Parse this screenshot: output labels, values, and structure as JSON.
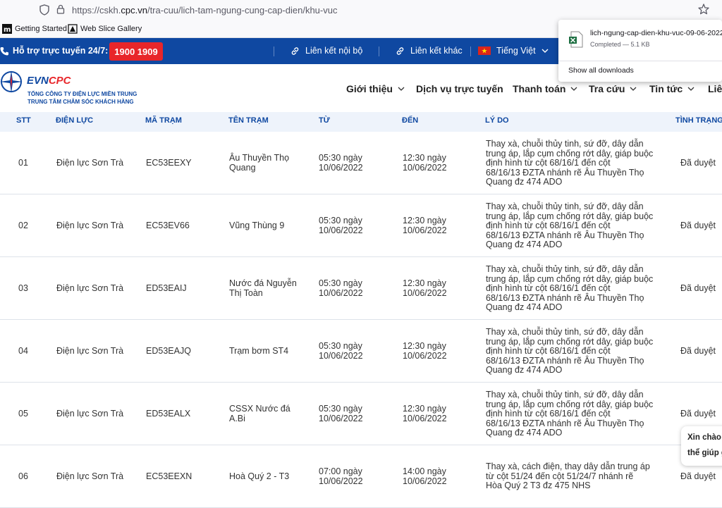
{
  "browser": {
    "url_prefix": "https://cskh.",
    "url_domain": "cpc.vn",
    "url_path": "/tra-cuu/lich-tam-ngung-cung-cap-dien/khu-vuc",
    "bookmarks": [
      "Getting Started",
      "Web Slice Gallery"
    ]
  },
  "downloads": {
    "file_name": "lich-ngung-cap-dien-khu-vuc-09-06-2022",
    "status": "Completed — 5.1 KB",
    "show_all": "Show all downloads"
  },
  "topbar": {
    "support_label": "Hỗ trợ trực tuyến 24/7:",
    "hotline": "1900 1909",
    "link_internal": "Liên kết nội bộ",
    "link_other": "Liên kết khác",
    "language": "Tiếng Việt",
    "colors": {
      "bar": "#0f48a1",
      "hotline": "#e8262a"
    }
  },
  "header": {
    "logo_evn": "EVN",
    "logo_cpc": "CPC",
    "logo_line1": "TỔNG CÔNG TY ĐIỆN LỰC MIỀN TRUNG",
    "logo_line2": "TRUNG TÂM CHĂM SÓC KHÁCH HÀNG",
    "nav": [
      "Giới thiệu",
      "Dịch vụ trực tuyến",
      "Thanh toán",
      "Tra cứu",
      "Tin tức",
      "Liê"
    ]
  },
  "table": {
    "headers": [
      "STT",
      "ĐIỆN LỰC",
      "MÃ TRẠM",
      "TÊN TRẠM",
      "TỪ",
      "ĐẾN",
      "LÝ DO",
      "TÌNH TRẠNG"
    ],
    "rows": [
      {
        "stt": "01",
        "dien_luc": "Điện lực Sơn Trà",
        "ma_tram": "EC53EEXY",
        "ten_tram": [
          "Âu Thuyền Thọ",
          "Quang"
        ],
        "tu": [
          "05:30 ngày",
          "10/06/2022"
        ],
        "den": [
          "12:30 ngày",
          "10/06/2022"
        ],
        "ly_do": [
          "Thay xà, chuỗi thủy tinh, sứ đỡ, dây dẫn",
          "trung áp, lắp cụm chống rớt dây, giáp buộc",
          "định hình từ cột 68/16/1 đến cột",
          "68/16/13 ĐZTA nhánh rẽ Âu Thuyền Thọ",
          "Quang đz 474 ADO"
        ],
        "tinh_trang": "Đã duyệt"
      },
      {
        "stt": "02",
        "dien_luc": "Điện lực Sơn Trà",
        "ma_tram": "EC53EV66",
        "ten_tram": [
          "Vũng Thùng 9"
        ],
        "tu": [
          "05:30 ngày",
          "10/06/2022"
        ],
        "den": [
          "12:30 ngày",
          "10/06/2022"
        ],
        "ly_do": [
          "Thay xà, chuỗi thủy tinh, sứ đỡ, dây dẫn",
          "trung áp, lắp cụm chống rớt dây, giáp buộc",
          "định hình từ cột 68/16/1 đến cột",
          "68/16/13 ĐZTA nhánh rẽ Âu Thuyền Thọ",
          "Quang đz 474 ADO"
        ],
        "tinh_trang": "Đã duyệt"
      },
      {
        "stt": "03",
        "dien_luc": "Điện lực Sơn Trà",
        "ma_tram": "ED53EAIJ",
        "ten_tram": [
          "Nước đá Nguyễn",
          "Thị Toàn"
        ],
        "tu": [
          "05:30 ngày",
          "10/06/2022"
        ],
        "den": [
          "12:30 ngày",
          "10/06/2022"
        ],
        "ly_do": [
          "Thay xà, chuỗi thủy tinh, sứ đỡ, dây dẫn",
          "trung áp, lắp cụm chống rớt dây, giáp buộc",
          "định hình từ cột 68/16/1 đến cột",
          "68/16/13 ĐZTA nhánh rẽ Âu Thuyền Thọ",
          "Quang đz 474 ADO"
        ],
        "tinh_trang": "Đã duyệt"
      },
      {
        "stt": "04",
        "dien_luc": "Điện lực Sơn Trà",
        "ma_tram": "ED53EAJQ",
        "ten_tram": [
          "Trạm bơm ST4"
        ],
        "tu": [
          "05:30 ngày",
          "10/06/2022"
        ],
        "den": [
          "12:30 ngày",
          "10/06/2022"
        ],
        "ly_do": [
          "Thay xà, chuỗi thủy tinh, sứ đỡ, dây dẫn",
          "trung áp, lắp cụm chống rớt dây, giáp buộc",
          "định hình từ cột 68/16/1 đến cột",
          "68/16/13 ĐZTA nhánh rẽ Âu Thuyền Thọ",
          "Quang đz 474 ADO"
        ],
        "tinh_trang": "Đã duyệt"
      },
      {
        "stt": "05",
        "dien_luc": "Điện lực Sơn Trà",
        "ma_tram": "ED53EALX",
        "ten_tram": [
          "CSSX Nước đá",
          "A.Bi"
        ],
        "tu": [
          "05:30 ngày",
          "10/06/2022"
        ],
        "den": [
          "12:30 ngày",
          "10/06/2022"
        ],
        "ly_do": [
          "Thay xà, chuỗi thủy tinh, sứ đỡ, dây dẫn",
          "trung áp, lắp cụm chống rớt dây, giáp buộc",
          "định hình từ cột 68/16/1 đến cột",
          "68/16/13 ĐZTA nhánh rẽ Âu Thuyền Thọ",
          "Quang đz 474 ADO"
        ],
        "tinh_trang": "Đã duyệt"
      },
      {
        "stt": "06",
        "dien_luc": "Điện lực Sơn Trà",
        "ma_tram": "EC53EEXN",
        "ten_tram": [
          "Hoà Quý 2 - T3"
        ],
        "tu": [
          "07:00 ngày",
          "10/06/2022"
        ],
        "den": [
          "14:00 ngày",
          "10/06/2022"
        ],
        "ly_do": [
          "Thay xà, cách điện, thay dây dẫn trung áp",
          "từ cột 51/24 đến cột 51/24/7 nhánh rẽ",
          "Hòa Quý 2 T3 đz 475 NHS"
        ],
        "tinh_trang": "Đã duyệt"
      }
    ]
  },
  "chat": {
    "line1": "Xin chào!",
    "line2": "thể giúp g"
  }
}
